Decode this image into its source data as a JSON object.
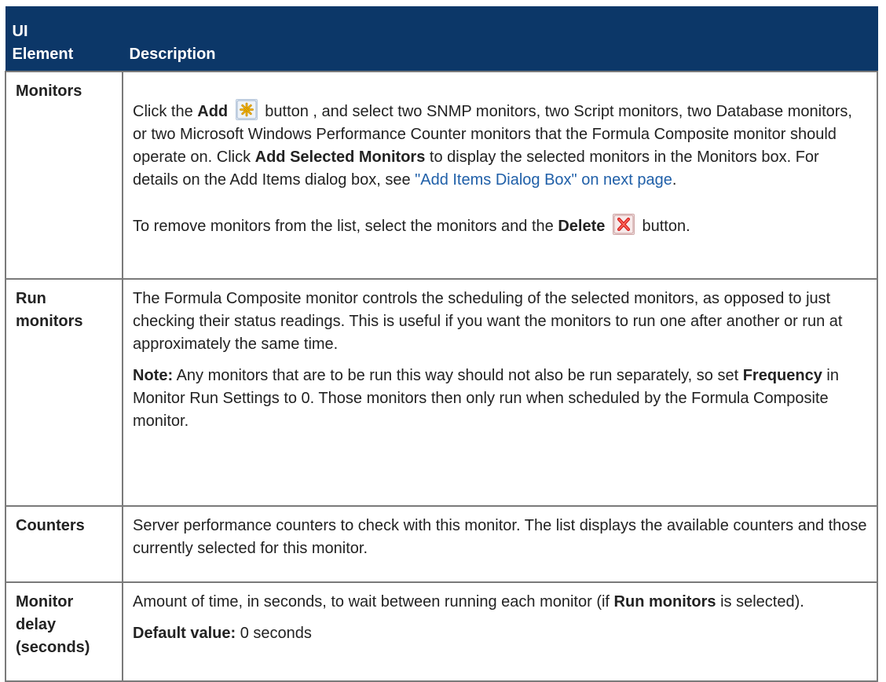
{
  "table": {
    "header_ui": "UI",
    "header_element": "Element",
    "header_description": "Description"
  },
  "rows": {
    "monitors": {
      "name": "Monitors",
      "p1_t1": "Click the ",
      "p1_add": "Add",
      "p1_t2": " button , and select two SNMP monitors, two Script monitors, two Database monitors, or two Microsoft Windows Performance Counter monitors that the Formula Composite monitor should operate on. Click ",
      "p1_add_selected": "Add Selected Monitors",
      "p1_t3": " to display the selected monitors in the Monitors box. For details on the Add Items dialog box, see ",
      "p1_link": "\"Add Items Dialog Box\" on next page",
      "p1_t4": ".",
      "p2_t1": "To remove monitors from the list, select the monitors and the ",
      "p2_delete": "Delete",
      "p2_t2": " button."
    },
    "run_monitors": {
      "name_line1": "Run",
      "name_line2": "monitors",
      "p1": "The Formula Composite monitor controls the scheduling of the selected monitors, as opposed to just checking their status readings. This is useful if you want the monitors to run one after another or run at approximately the same time.",
      "note_label": "Note:",
      "note_t1": " Any monitors that are to be run this way should not also be run separately, so set ",
      "note_frequency": "Frequency",
      "note_t2": " in Monitor Run Settings to 0. Those monitors then only run when scheduled by the Formula Composite monitor."
    },
    "counters": {
      "name": "Counters",
      "p1": "Server performance counters to check with this monitor. The list displays the available counters and those currently selected for this monitor."
    },
    "monitor_delay": {
      "name_line1": "Monitor",
      "name_line2": "delay",
      "name_line3": "(seconds)",
      "p1_t1": "Amount of time, in seconds, to wait between running each monitor (if ",
      "p1_run_monitors": "Run monitors",
      "p1_t2": " is selected).",
      "default_label": "Default value:",
      "default_value": " 0 seconds"
    }
  },
  "icons": {
    "add": "add-icon",
    "delete": "delete-icon"
  },
  "colors": {
    "header_bg": "#0c3768",
    "link": "#1f5fa8"
  }
}
